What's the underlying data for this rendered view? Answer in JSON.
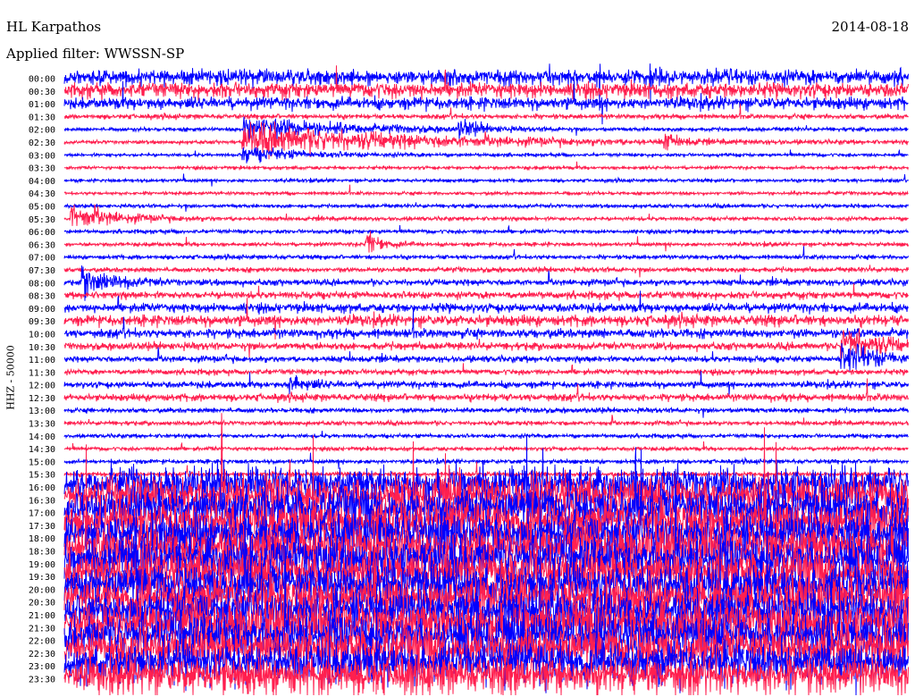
{
  "chart_data": {
    "type": "line",
    "title": "HL Karpathos",
    "date": "2014-08-18",
    "filter": "Applied filter: WWSSN-SP",
    "ylabel": "HHZ - 50000",
    "xlabel": "",
    "minutes_per_line": 30,
    "series_colors": [
      "#0000ff",
      "#ff1f4f"
    ],
    "row_labels": [
      "00:00",
      "00:30",
      "01:00",
      "01:30",
      "02:00",
      "02:30",
      "03:00",
      "03:30",
      "04:00",
      "04:30",
      "05:00",
      "05:30",
      "06:00",
      "06:30",
      "07:00",
      "07:30",
      "08:00",
      "08:30",
      "09:00",
      "09:30",
      "10:00",
      "10:30",
      "11:00",
      "11:30",
      "12:00",
      "12:30",
      "13:00",
      "13:30",
      "14:00",
      "14:30",
      "15:00",
      "15:30",
      "16:00",
      "16:30",
      "17:00",
      "17:30",
      "18:00",
      "18:30",
      "19:00",
      "19:30",
      "20:00",
      "20:30",
      "21:00",
      "21:30",
      "22:00",
      "22:30",
      "23:00",
      "23:30"
    ],
    "activity_level": [
      5,
      5,
      4,
      1.6,
      1.3,
      1.2,
      1.1,
      1.1,
      1.1,
      1.1,
      1.2,
      1.3,
      1.3,
      1.3,
      1.4,
      1.6,
      2,
      2.4,
      3,
      3.6,
      3,
      2.4,
      2,
      1.8,
      2.2,
      2.4,
      1.6,
      1.4,
      1.3,
      1.3,
      1.4,
      1.6,
      9,
      11,
      12,
      12,
      12,
      12,
      12,
      12,
      12,
      12,
      12,
      12,
      12,
      12,
      11,
      10
    ],
    "events": [
      {
        "row": 4,
        "minute": 6.3,
        "amp": 10,
        "duration": 3
      },
      {
        "row": 5,
        "minute": 6.3,
        "amp": 12,
        "duration": 6
      },
      {
        "row": 6,
        "minute": 6.3,
        "amp": 6,
        "duration": 2
      },
      {
        "row": 4,
        "minute": 14.0,
        "amp": 8,
        "duration": 0.6
      },
      {
        "row": 5,
        "minute": 21.3,
        "amp": 6,
        "duration": 0.5
      },
      {
        "row": 11,
        "minute": 0.2,
        "amp": 10,
        "duration": 1.5
      },
      {
        "row": 13,
        "minute": 10.7,
        "amp": 9,
        "duration": 0.6
      },
      {
        "row": 16,
        "minute": 0.6,
        "amp": 12,
        "duration": 1
      },
      {
        "row": 21,
        "minute": 27.6,
        "amp": 14,
        "duration": 1.3
      },
      {
        "row": 22,
        "minute": 27.6,
        "amp": 12,
        "duration": 1.3
      },
      {
        "row": 24,
        "minute": 8.0,
        "amp": 8,
        "duration": 0.6
      },
      {
        "row": 0,
        "minute": 20.8,
        "amp": 22,
        "duration": 0.1
      }
    ]
  }
}
